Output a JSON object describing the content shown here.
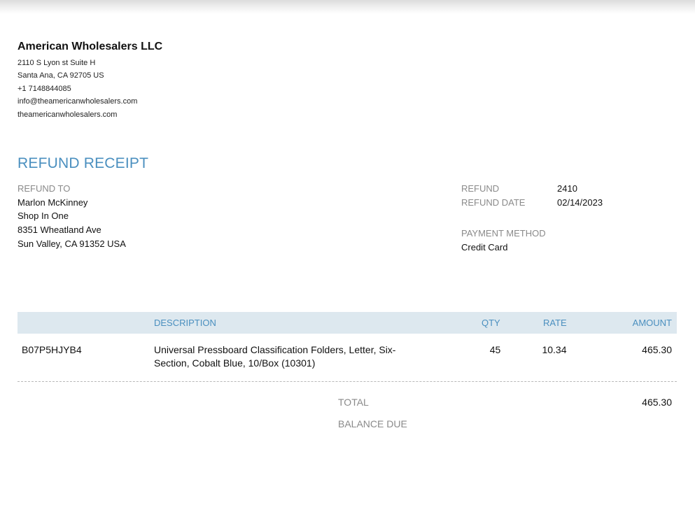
{
  "company": {
    "name": "American Wholesalers LLC",
    "address_line1": "2110 S Lyon st Suite H",
    "address_line2": "Santa Ana, CA  92705 US",
    "phone": "+1 7148844085",
    "email": "info@theamericanwholesalers.com",
    "website": "theamericanwholesalers.com"
  },
  "document": {
    "title": "REFUND RECEIPT"
  },
  "refund_to": {
    "label": "REFUND TO",
    "name": "Marlon McKinney",
    "company": "Shop In One",
    "street": "8351 Wheatland Ave",
    "city_state": "Sun Valley, CA  91352 USA"
  },
  "refund_info": {
    "refund_label": "REFUND",
    "refund_number": "2410",
    "date_label": "REFUND DATE",
    "date_value": "02/14/2023",
    "payment_method_label": "PAYMENT METHOD",
    "payment_method_value": "Credit Card"
  },
  "table": {
    "headers": {
      "description": "DESCRIPTION",
      "qty": "QTY",
      "rate": "RATE",
      "amount": "AMOUNT"
    },
    "rows": [
      {
        "sku": "B07P5HJYB4",
        "description_line1": "Universal Pressboard Classification Folders, Letter, Six-",
        "description_line2": "Section, Cobalt Blue, 10/Box (10301)",
        "qty": "45",
        "rate": "10.34",
        "amount": "465.30"
      }
    ]
  },
  "totals": {
    "total_label": "TOTAL",
    "total_value": "465.30",
    "balance_due_label": "BALANCE DUE",
    "balance_due_value": ""
  }
}
